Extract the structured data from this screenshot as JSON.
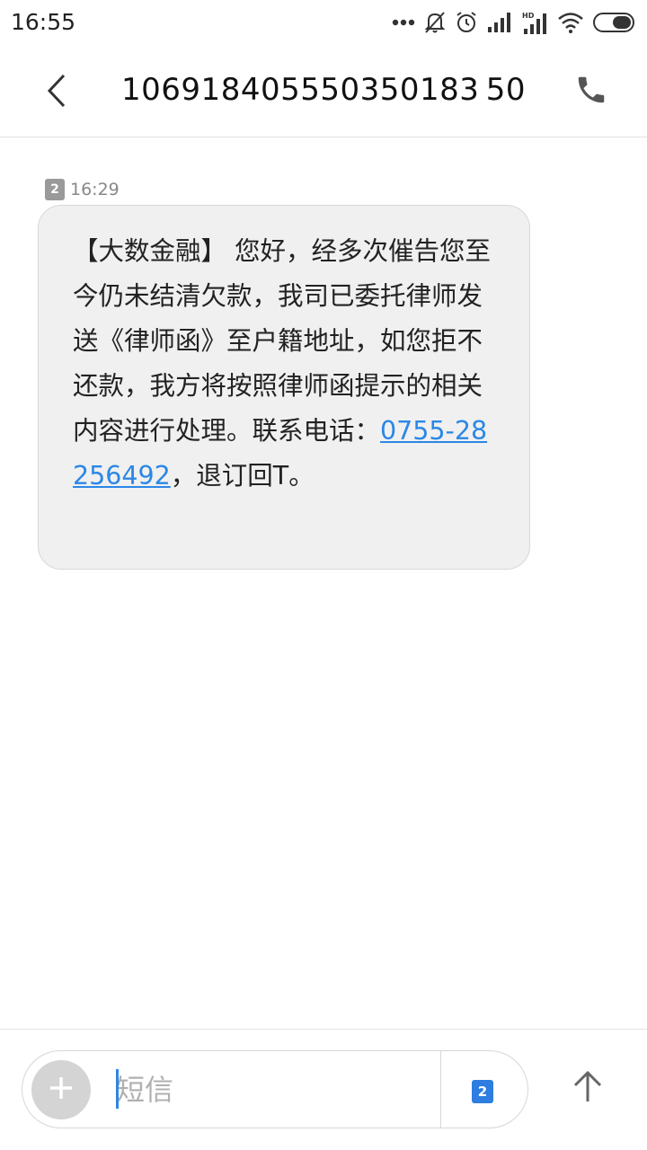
{
  "status_bar": {
    "time": "16:55",
    "icons": [
      "more-dots-icon",
      "mute-bell-icon",
      "alarm-icon",
      "signal-icon",
      "hd-signal-icon",
      "wifi-icon",
      "battery-icon"
    ]
  },
  "header": {
    "title": "106918405550350183 50",
    "back_icon": "chevron-left-icon",
    "call_icon": "phone-icon"
  },
  "message": {
    "sim_label": "2",
    "time": "16:29",
    "text_before_link": "【大数金融】         您好，经多次催告您至今仍未结清欠款，我司已委托律师发送《律师函》至户籍地址，如您拒不还款，我方将按照律师函提示的相关内容进行处理。联系电话：",
    "link": "0755-28256492",
    "text_after_link": "，退订回T。"
  },
  "composer": {
    "placeholder": "短信",
    "sim_label": "2",
    "add_icon": "plus-icon",
    "send_icon": "arrow-up-icon"
  },
  "colors": {
    "accent": "#2b87e6",
    "bubble_bg": "#f0f0f0",
    "sim_badge_active": "#2e7de0"
  }
}
